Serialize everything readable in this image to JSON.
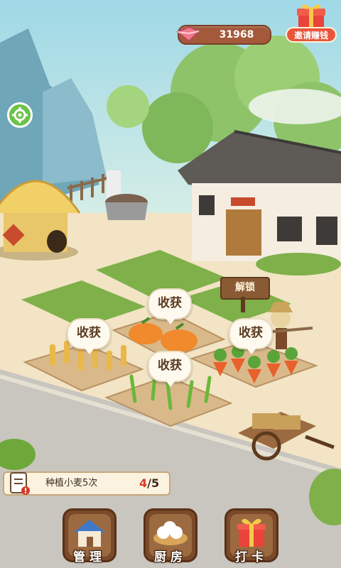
{
  "hud": {
    "currency_value": "31968",
    "invite_label": "邀请赚钱"
  },
  "farm": {
    "harvest_labels": [
      "收获",
      "收获",
      "收获",
      "收获"
    ],
    "unlock_sign": "解锁",
    "plots": [
      {
        "crop": "wheat",
        "status": "ready"
      },
      {
        "crop": "pumpkin",
        "status": "ready"
      },
      {
        "crop": "carrot",
        "status": "ready"
      },
      {
        "crop": "scallion",
        "status": "ready"
      }
    ]
  },
  "task": {
    "text": "种植小麦5次",
    "progress_current": "4",
    "progress_total": "/5"
  },
  "nav": [
    {
      "label": "管理",
      "icon": "house-icon"
    },
    {
      "label": "厨房",
      "icon": "steamed-bun-icon"
    },
    {
      "label": "打卡",
      "icon": "gift-icon"
    }
  ],
  "colors": {
    "accent_red": "#e9543b",
    "wood_brown": "#7a4a2a",
    "grass_green": "#7fb04a"
  }
}
